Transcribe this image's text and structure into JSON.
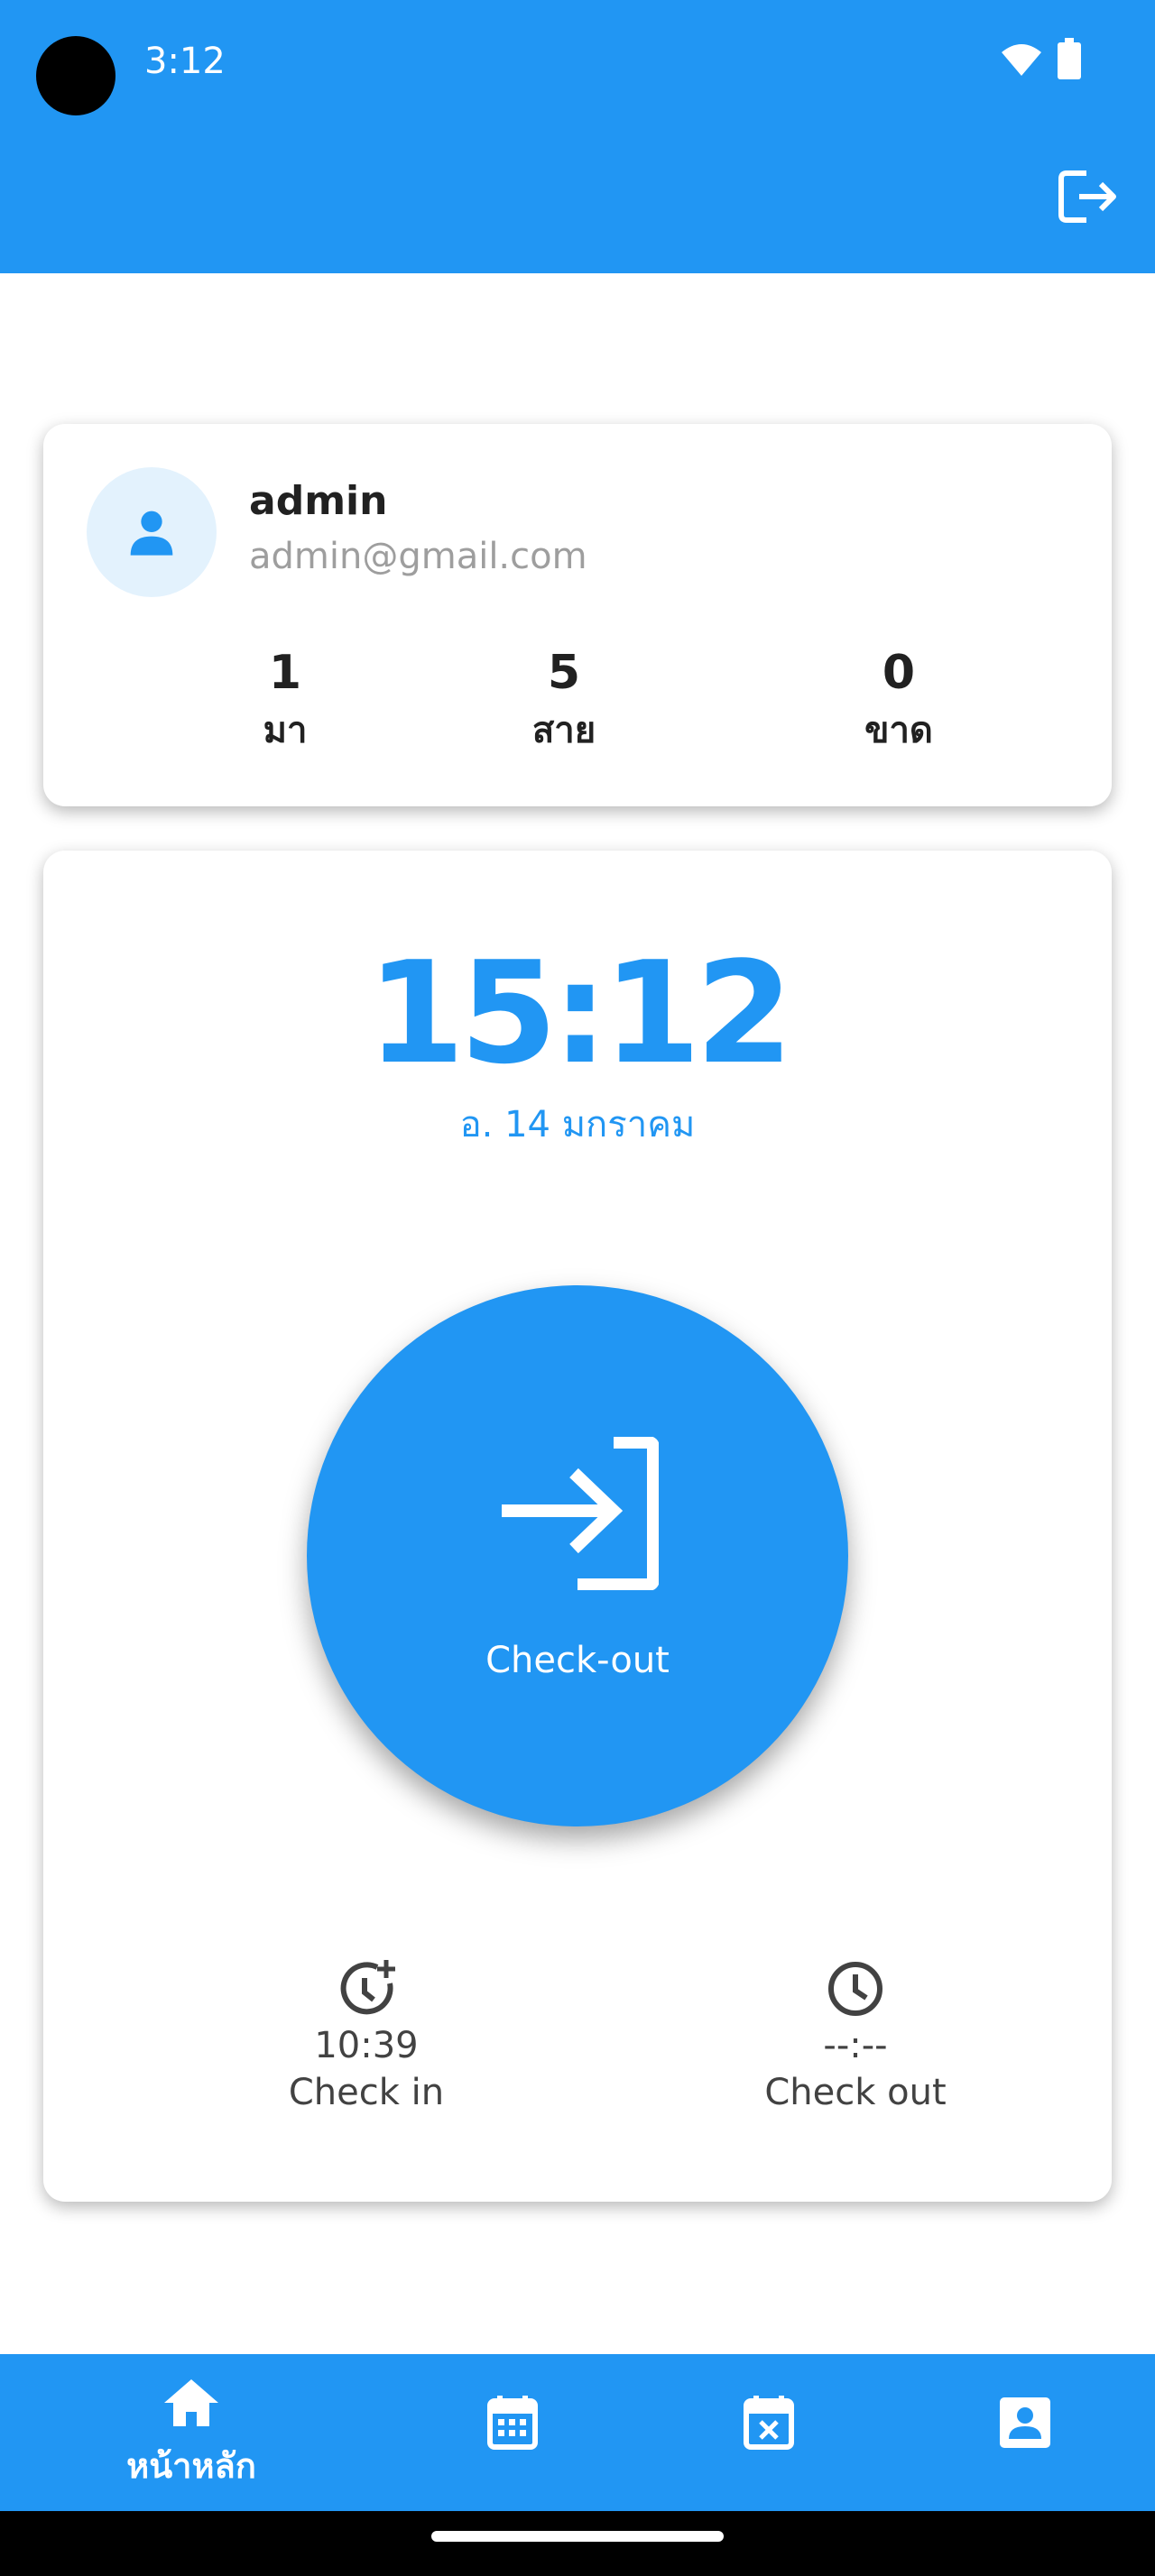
{
  "status_bar": {
    "time": "3:12"
  },
  "app_bar": {
    "logout_icon": "logout-icon"
  },
  "profile": {
    "name": "admin",
    "email": "admin@gmail.com",
    "stats": [
      {
        "value": "1",
        "label": "มา"
      },
      {
        "value": "5",
        "label": "สาย"
      },
      {
        "value": "0",
        "label": "ขาด"
      }
    ]
  },
  "clock": {
    "time": "15:12",
    "date": "อ. 14 มกราคม",
    "button_label": "Check-out",
    "button_icon": "login-arrow-icon"
  },
  "summary": {
    "check_in": {
      "time": "10:39",
      "label": "Check in",
      "icon": "alarm-add-icon"
    },
    "check_out": {
      "time": "--:--",
      "label": "Check out",
      "icon": "clock-icon"
    }
  },
  "bottom_nav": {
    "items": [
      {
        "label": "หน้าหลัก",
        "icon": "home-icon",
        "active": true
      },
      {
        "icon": "calendar-icon"
      },
      {
        "icon": "calendar-cancel-icon"
      },
      {
        "icon": "profile-icon"
      }
    ]
  },
  "colors": {
    "primary": "#2196F3",
    "text": "#212121",
    "muted": "#9E9E9E"
  }
}
